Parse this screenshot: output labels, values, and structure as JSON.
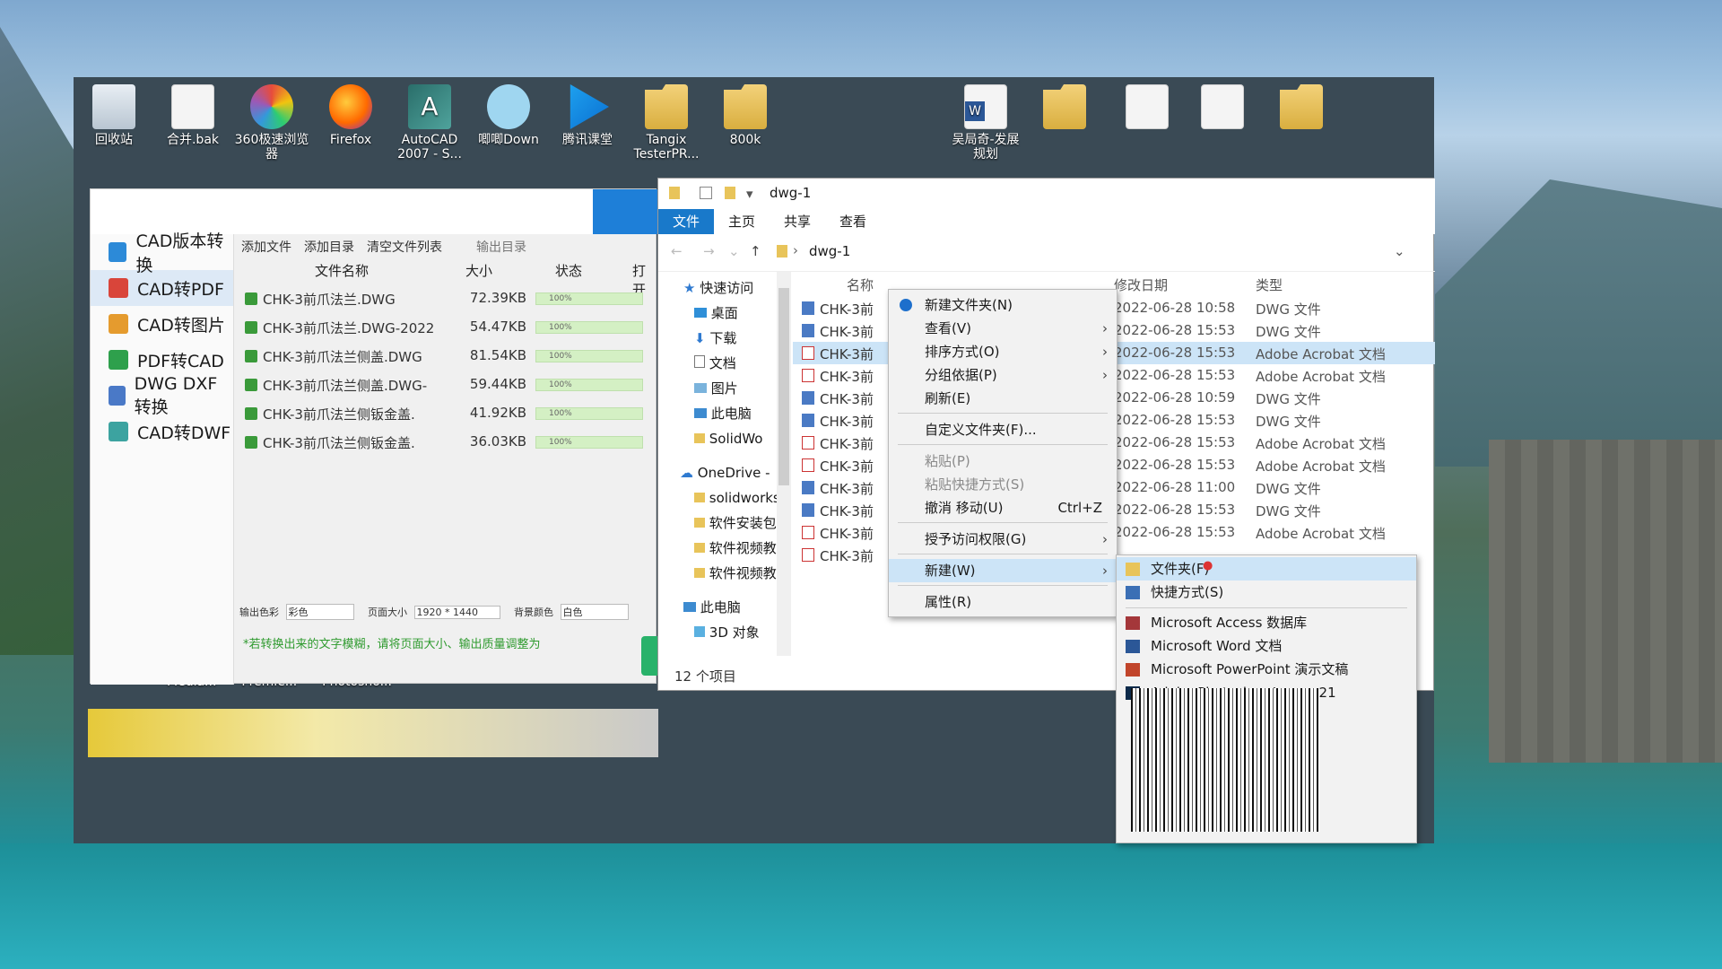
{
  "desktop": {
    "icons": [
      {
        "label": "回收站",
        "kind": "recycle-bin-icon"
      },
      {
        "label": "合并.bak",
        "kind": "file-icon"
      },
      {
        "label": "360极速浏览器",
        "kind": "browser-icon"
      },
      {
        "label": "Firefox",
        "kind": "firefox-icon"
      },
      {
        "label": "AutoCAD 2007 - S...",
        "kind": "autocad-icon"
      },
      {
        "label": "唧唧Down",
        "kind": "jijidown-icon"
      },
      {
        "label": "腾讯课堂",
        "kind": "tencent-classroom-icon"
      },
      {
        "label": "Tangix TesterPR...",
        "kind": "folder-icon"
      },
      {
        "label": "800k",
        "kind": "folder-icon"
      },
      {
        "label": "吴局奇-发展规划",
        "kind": "word-doc-icon"
      }
    ],
    "bottom_labels": [
      "Media...",
      "Premie...",
      "Photosho..."
    ]
  },
  "cad_app": {
    "sidebar": [
      "CAD版本转换",
      "CAD转PDF",
      "CAD转图片",
      "PDF转CAD",
      "DWG DXF转换",
      "CAD转DWF"
    ],
    "toolbar": {
      "add_file": "添加文件",
      "add_dir": "添加目录",
      "clear": "清空文件列表",
      "output_dir": "输出目录"
    },
    "columns": {
      "name": "文件名称",
      "size": "大小",
      "status": "状态",
      "open": "打开"
    },
    "rows": [
      {
        "name": "CHK-3前爪法兰.DWG",
        "size": "72.39KB",
        "progress": "100%"
      },
      {
        "name": "CHK-3前爪法兰.DWG-2022",
        "size": "54.47KB",
        "progress": "100%"
      },
      {
        "name": "CHK-3前爪法兰侧盖.DWG",
        "size": "81.54KB",
        "progress": "100%"
      },
      {
        "name": "CHK-3前爪法兰侧盖.DWG-",
        "size": "59.44KB",
        "progress": "100%"
      },
      {
        "name": "CHK-3前爪法兰侧钣金盖.",
        "size": "41.92KB",
        "progress": "100%"
      },
      {
        "name": "CHK-3前爪法兰侧钣金盖.",
        "size": "36.03KB",
        "progress": "100%"
      }
    ],
    "options": {
      "color_label": "输出色彩",
      "color_value": "彩色",
      "page_label": "页面大小",
      "page_value": "1920 * 1440",
      "bg_label": "背景颜色",
      "bg_value": "白色"
    },
    "warning": "*若转换出来的文字模糊，请将页面大小、输出质量调整为"
  },
  "explorer": {
    "title": "dwg-1",
    "ribbon": [
      "文件",
      "主页",
      "共享",
      "查看"
    ],
    "breadcrumb": "dwg-1",
    "nav_items": [
      "快速访问",
      "桌面",
      "下载",
      "文档",
      "图片",
      "此电脑",
      "SolidWo",
      "OneDrive -",
      "solidworks",
      "软件安装包",
      "软件视频教",
      "软件视频教",
      "此电脑",
      "3D 对象"
    ],
    "headers": {
      "name": "名称",
      "date": "修改日期",
      "type": "类型"
    },
    "files": [
      {
        "name": "CHK-3前",
        "date": "2022-06-28 10:58",
        "type": "DWG 文件",
        "kind": "dwg"
      },
      {
        "name": "CHK-3前",
        "date": "2022-06-28 15:53",
        "type": "DWG 文件",
        "kind": "dwg"
      },
      {
        "name": "CHK-3前",
        "date": "2022-06-28 15:53",
        "type": "Adobe Acrobat 文档",
        "kind": "pdf"
      },
      {
        "name": "CHK-3前",
        "date": "2022-06-28 15:53",
        "type": "Adobe Acrobat 文档",
        "kind": "pdf"
      },
      {
        "name": "CHK-3前",
        "date": "2022-06-28 10:59",
        "type": "DWG 文件",
        "kind": "dwg"
      },
      {
        "name": "CHK-3前",
        "date": "2022-06-28 15:53",
        "type": "DWG 文件",
        "kind": "dwg"
      },
      {
        "name": "CHK-3前",
        "date": "2022-06-28 15:53",
        "type": "Adobe Acrobat 文档",
        "kind": "pdf"
      },
      {
        "name": "CHK-3前",
        "date": "2022-06-28 15:53",
        "type": "Adobe Acrobat 文档",
        "kind": "pdf"
      },
      {
        "name": "CHK-3前",
        "date": "2022-06-28 11:00",
        "type": "DWG 文件",
        "kind": "dwg"
      },
      {
        "name": "CHK-3前",
        "date": "2022-06-28 15:53",
        "type": "DWG 文件",
        "kind": "dwg"
      },
      {
        "name": "CHK-3前",
        "date": "2022-06-28 15:53",
        "type": "Adobe Acrobat 文档",
        "kind": "pdf"
      },
      {
        "name": "CHK-3前",
        "date": "",
        "type": "",
        "kind": "pdf"
      }
    ],
    "status": "12 个项目"
  },
  "context_menu": {
    "items": [
      "新建文件夹(N)",
      "查看(V)",
      "排序方式(O)",
      "分组依据(P)",
      "刷新(E)",
      "自定义文件夹(F)...",
      "粘贴(P)",
      "粘贴快捷方式(S)",
      "撤消 移动(U)",
      "授予访问权限(G)",
      "新建(W)",
      "属性(R)"
    ],
    "undo_shortcut": "Ctrl+Z"
  },
  "new_submenu": {
    "items": [
      "文件夹(F)",
      "快捷方式(S)",
      "Microsoft Access 数据库",
      "Microsoft Word 文档",
      "Microsoft PowerPoint 演示文稿",
      "Adobe Photoshop Image 21"
    ]
  },
  "colors": {
    "accent": "#1979ca",
    "progress": "#d4f0c4",
    "highlight": "#cce4f7"
  }
}
